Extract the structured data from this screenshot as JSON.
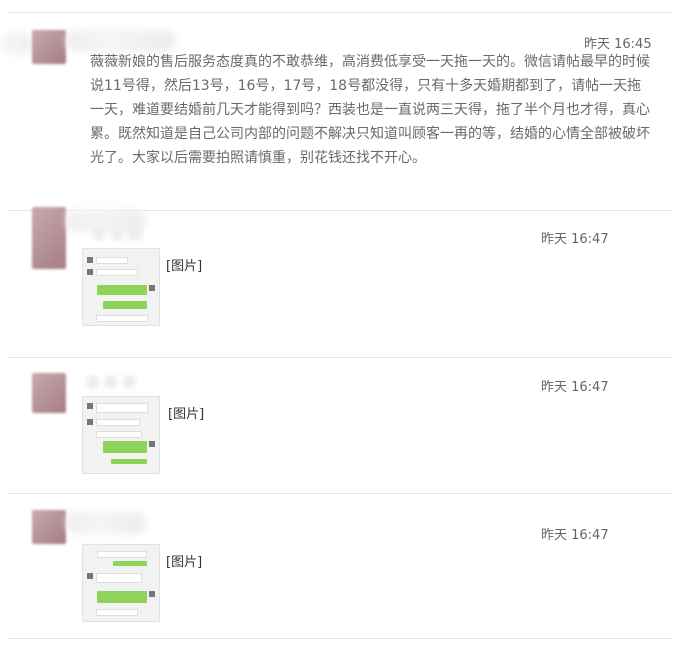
{
  "posts": [
    {
      "time": "昨天 16:45",
      "text": "薇薇新娘的售后服务态度真的不敢恭维，高消费低享受一天拖一天的。微信请帖最早的时候说11号得，然后13号，16号，17号，18号都没得，只有十多天婚期都到了，请帖一天拖一天，难道要结婚前几天才能得到吗？西装也是一直说两三天得，拖了半个月也才得，真心累。既然知道是自己公司内部的问题不解决只知道叫顾客一再的等，结婚的心情全部被破坏光了。大家以后需要拍照请慎重，别花钱还找不开心。"
    },
    {
      "time": "昨天 16:47",
      "image_label": "[图片]"
    },
    {
      "time": "昨天 16:47",
      "image_label": "[图片]"
    },
    {
      "time": "昨天 16:47",
      "image_label": "[图片]"
    }
  ],
  "colors": {
    "accent_green": "#8fd35a",
    "divider": "#e6e6e6",
    "avatar": "#a57e86"
  }
}
